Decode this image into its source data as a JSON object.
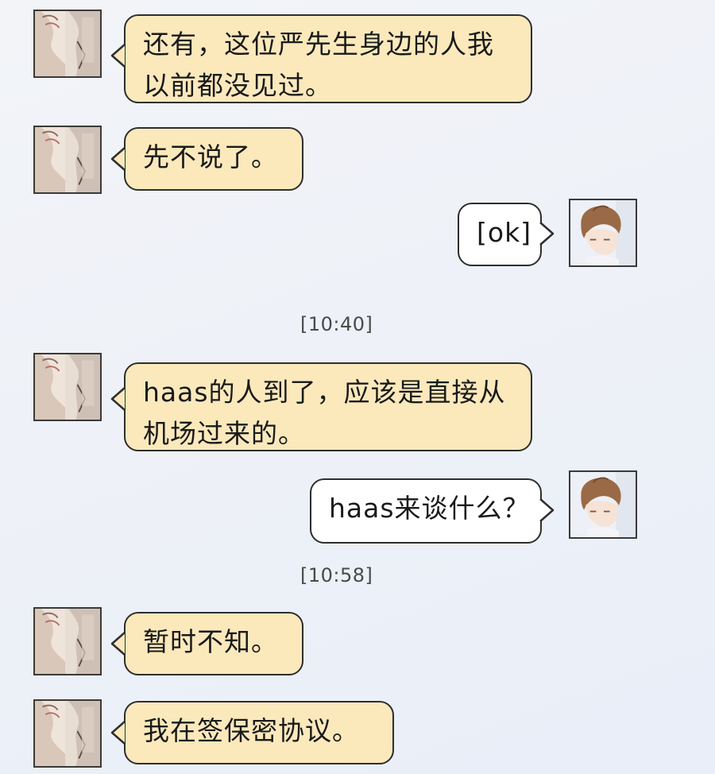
{
  "colors": {
    "incoming_bubble": "#fbe9bc",
    "outgoing_bubble": "#ffffff",
    "bubble_border": "#2e2e2e",
    "background": "#eef1f7"
  },
  "messages": [
    {
      "side": "left",
      "avatar": "contact-avatar",
      "lines": [
        "还有，这位严先生身边的人我",
        "以前都没见过。"
      ]
    },
    {
      "side": "left",
      "avatar": "contact-avatar",
      "lines": [
        "先不说了。"
      ]
    },
    {
      "side": "right",
      "avatar": "self-avatar",
      "lines": [
        "[ok]"
      ]
    },
    {
      "side": "left",
      "avatar": "contact-avatar",
      "lines": [
        "haas的人到了，应该是直接从",
        "机场过来的。"
      ]
    },
    {
      "side": "right",
      "avatar": "self-avatar",
      "lines": [
        "haas来谈什么？"
      ]
    },
    {
      "side": "left",
      "avatar": "contact-avatar",
      "lines": [
        "暂时不知。"
      ]
    },
    {
      "side": "left",
      "avatar": "contact-avatar",
      "lines": [
        "我在签保密协议。"
      ]
    }
  ],
  "timestamps": [
    "[10:40]",
    "[10:58]"
  ]
}
